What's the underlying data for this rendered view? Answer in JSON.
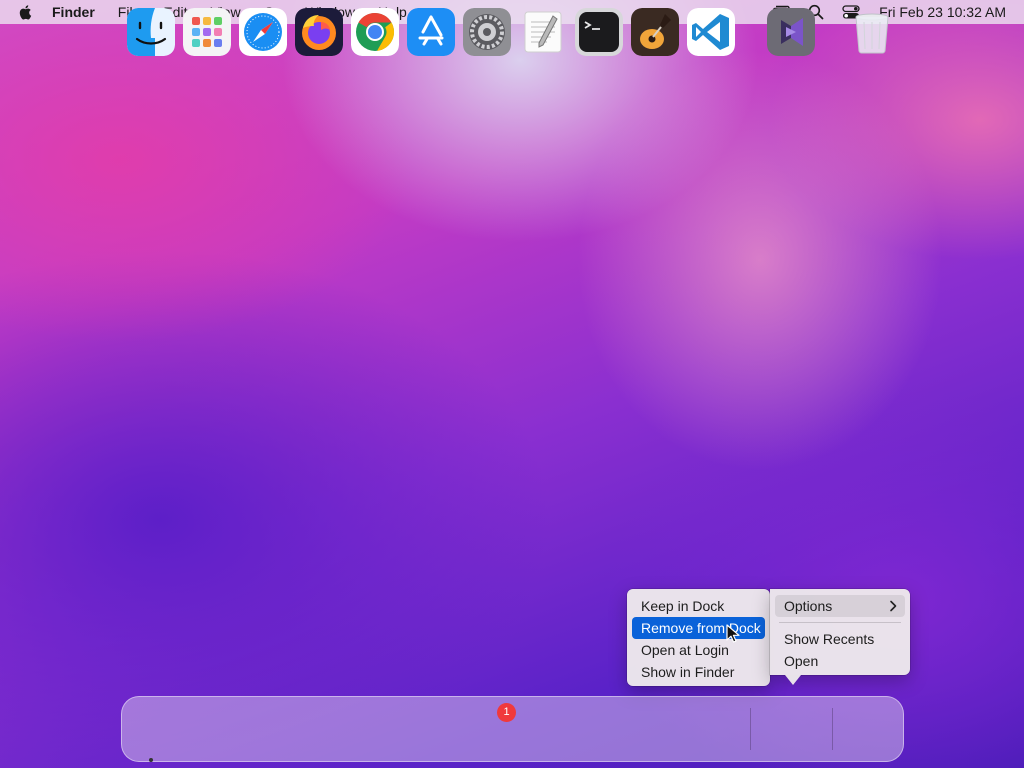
{
  "menubar": {
    "app_name": "Finder",
    "items": [
      "File",
      "Edit",
      "View",
      "Go",
      "Window",
      "Help"
    ],
    "clock": "Fri Feb 23  10:32 AM",
    "icons": [
      "screen-mirroring-icon",
      "spotlight-search-icon",
      "control-center-icon"
    ]
  },
  "context_menu": {
    "items": [
      {
        "label": "Keep in Dock"
      },
      {
        "label": "Remove from Dock",
        "highlighted": true
      },
      {
        "label": "Open at Login"
      },
      {
        "label": "Show in Finder"
      }
    ]
  },
  "submenu": {
    "options_label": "Options",
    "items": [
      {
        "label": "Show Recents"
      },
      {
        "label": "Open"
      }
    ]
  },
  "dock": {
    "apps": [
      "finder",
      "launchpad",
      "safari",
      "firefox",
      "chrome",
      "app-store",
      "system-settings",
      "textedit",
      "terminal",
      "garageband",
      "vscode",
      "visual-studio",
      "trash"
    ],
    "settings_badge": "1",
    "colors": {
      "accent": "#0a62d9",
      "badge": "#f0393c"
    }
  }
}
